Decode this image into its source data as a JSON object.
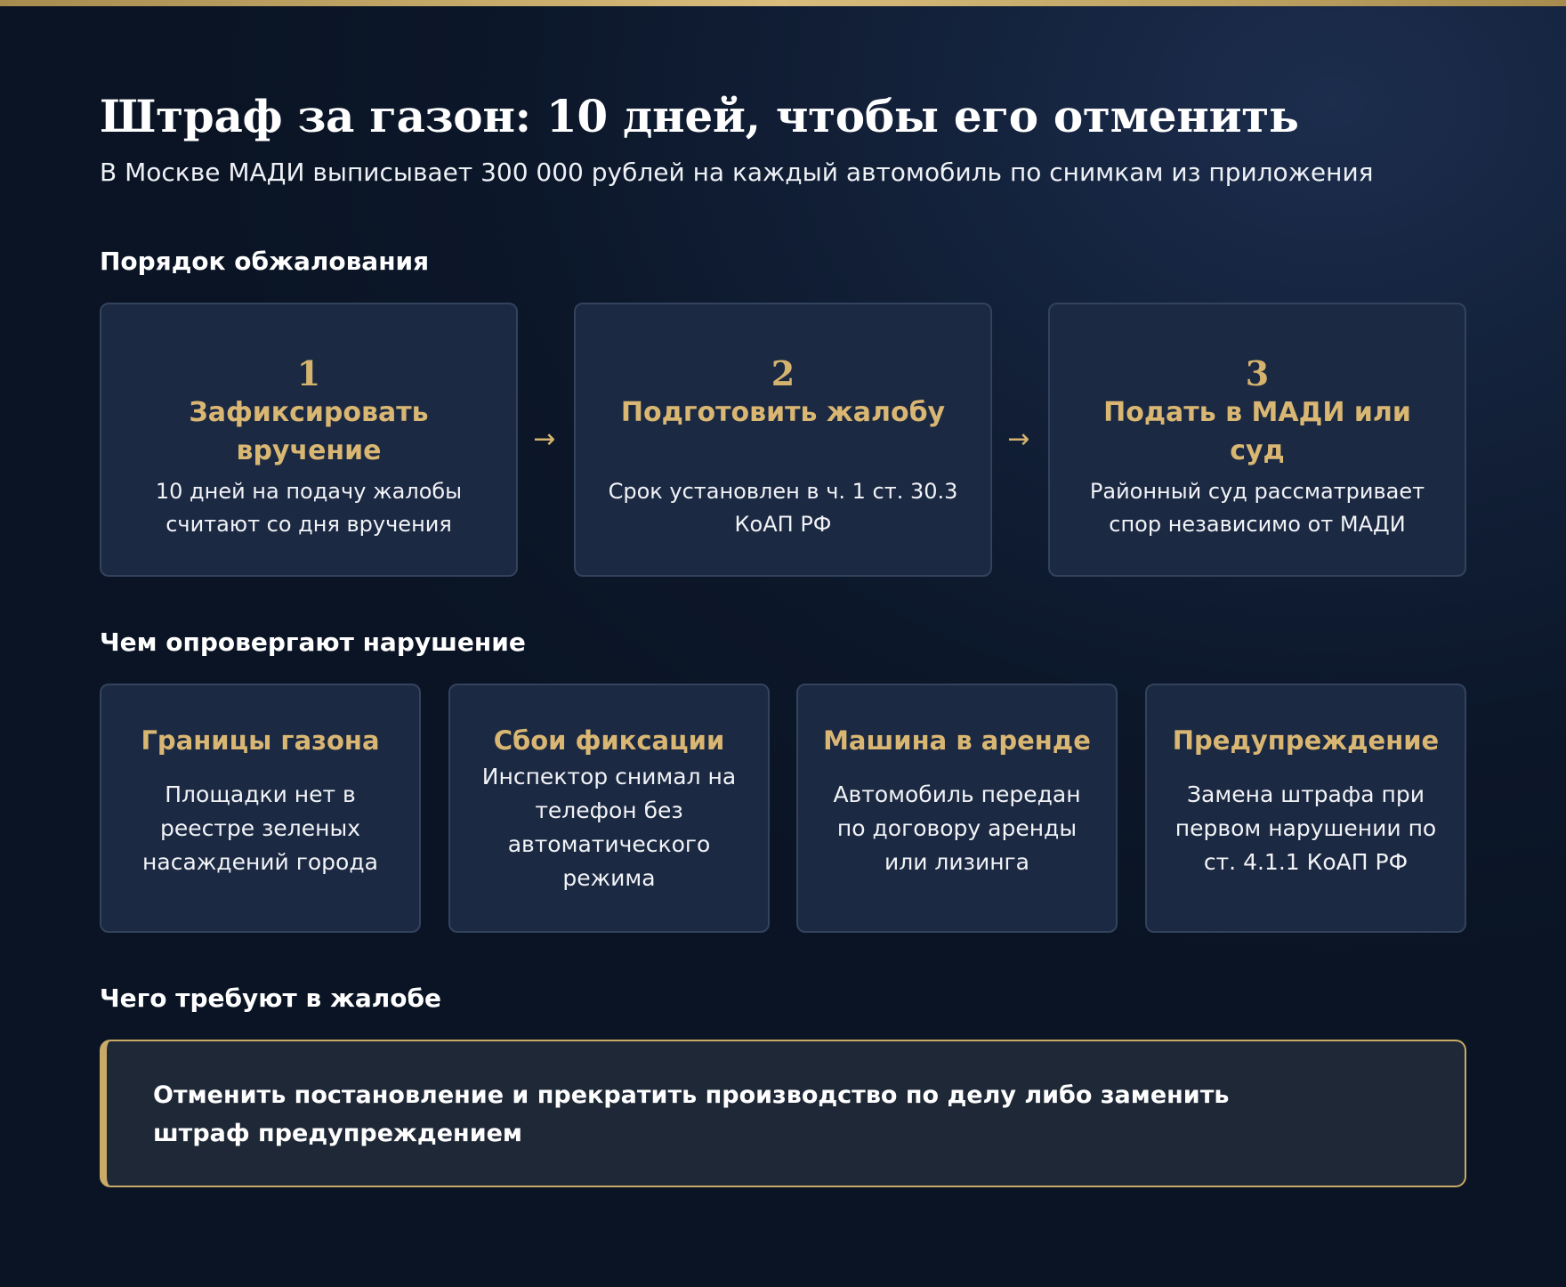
{
  "header": {
    "title": "Штраф за газон: 10 дней, чтобы его отменить",
    "subtitle": "В Москве МАДИ выписывает 300 000 рублей на каждый автомобиль по снимкам из приложения"
  },
  "appeal": {
    "heading": "Порядок обжалования",
    "steps": [
      {
        "number": "1",
        "title": "Зафиксировать вручение",
        "text": "10 дней на подачу жалобы считают со дня вручения"
      },
      {
        "number": "2",
        "title": "Подготовить жалобу",
        "text": "Срок установлен в ч. 1 ст. 30.3 КоАП РФ"
      },
      {
        "number": "3",
        "title": "Подать в МАДИ или суд",
        "text": "Районный суд рассматривает спор независимо от МАДИ"
      }
    ],
    "arrow": "→"
  },
  "refute": {
    "heading": "Чем опровергают нарушение",
    "items": [
      {
        "title": "Границы газона",
        "text": "Площадки нет в реестре зеленых насаждений города"
      },
      {
        "title": "Сбои фиксации",
        "text": "Инспектор снимал на телефон без автоматического режима"
      },
      {
        "title": "Машина в аренде",
        "text": "Автомобиль передан по договору аренды или лизинга"
      },
      {
        "title": "Предупреждение",
        "text": "Замена штрафа при первом нарушении по ст. 4.1.1 КоАП РФ"
      }
    ]
  },
  "demand": {
    "heading": "Чего требуют в жалобе",
    "text": "Отменить постановление и прекратить производство по делу либо заменить штраф предупреждением"
  },
  "colors": {
    "accent": "#d4b36e",
    "background": "#0c172a",
    "card": "#1c2942"
  }
}
